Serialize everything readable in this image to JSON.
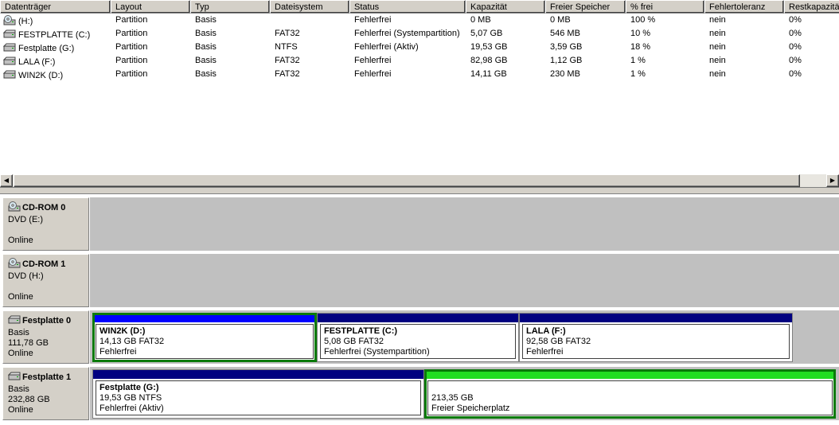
{
  "colors": {
    "primary_bar": "#000080",
    "selected_bar": "#0000ff",
    "free_bar": "#22dd22",
    "selection_border": "#0a7a0a"
  },
  "list": {
    "columns": [
      "Datenträger",
      "Layout",
      "Typ",
      "Dateisystem",
      "Status",
      "Kapazität",
      "Freier Speicher",
      "% frei",
      "Fehlertoleranz",
      "Restkapazität"
    ],
    "rows": [
      {
        "icon": "cd-drive-icon",
        "name": "(H:)",
        "layout": "Partition",
        "type": "Basis",
        "fs": "",
        "status": "Fehlerfrei",
        "capacity": "0 MB",
        "free": "0 MB",
        "pct": "100 %",
        "fault": "nein",
        "rest": "0%"
      },
      {
        "icon": "hard-disk-icon",
        "name": "FESTPLATTE (C:)",
        "layout": "Partition",
        "type": "Basis",
        "fs": "FAT32",
        "status": "Fehlerfrei (Systempartition)",
        "capacity": "5,07 GB",
        "free": "546 MB",
        "pct": "10 %",
        "fault": "nein",
        "rest": "0%"
      },
      {
        "icon": "hard-disk-icon",
        "name": "Festplatte (G:)",
        "layout": "Partition",
        "type": "Basis",
        "fs": "NTFS",
        "status": "Fehlerfrei (Aktiv)",
        "capacity": "19,53 GB",
        "free": "3,59 GB",
        "pct": "18 %",
        "fault": "nein",
        "rest": "0%"
      },
      {
        "icon": "hard-disk-icon",
        "name": "LALA (F:)",
        "layout": "Partition",
        "type": "Basis",
        "fs": "FAT32",
        "status": "Fehlerfrei",
        "capacity": "82,98 GB",
        "free": "1,12 GB",
        "pct": "1 %",
        "fault": "nein",
        "rest": "0%"
      },
      {
        "icon": "hard-disk-icon",
        "name": "WIN2K (D:)",
        "layout": "Partition",
        "type": "Basis",
        "fs": "FAT32",
        "status": "Fehlerfrei",
        "capacity": "14,11 GB",
        "free": "230 MB",
        "pct": "1 %",
        "fault": "nein",
        "rest": "0%"
      }
    ]
  },
  "disks": [
    {
      "icon": "cd-drive-icon",
      "title": "CD-ROM 0",
      "line1": "DVD (E:)",
      "line2": "",
      "line3": "Online",
      "partitions": []
    },
    {
      "icon": "cd-drive-icon",
      "title": "CD-ROM 1",
      "line1": "DVD (H:)",
      "line2": "",
      "line3": "Online",
      "partitions": []
    },
    {
      "icon": "hard-disk-icon",
      "title": "Festplatte 0",
      "line1": "Basis",
      "line2": "111,78 GB",
      "line3": "Online",
      "partitions": [
        {
          "name": "WIN2K  (D:)",
          "size": "14,13 GB FAT32",
          "status": "Fehlerfrei",
          "bar": "selected",
          "selected": true
        },
        {
          "name": "FESTPLATTE  (C:)",
          "size": "5,08 GB FAT32",
          "status": "Fehlerfrei (Systempartition)",
          "bar": "primary",
          "selected": false
        },
        {
          "name": "LALA  (F:)",
          "size": "92,58 GB FAT32",
          "status": "Fehlerfrei",
          "bar": "primary",
          "selected": false
        }
      ]
    },
    {
      "icon": "hard-disk-icon",
      "title": "Festplatte 1",
      "line1": "Basis",
      "line2": "232,88 GB",
      "line3": "Online",
      "partitions": [
        {
          "name": "Festplatte  (G:)",
          "size": "19,53 GB NTFS",
          "status": "Fehlerfrei (Aktiv)",
          "bar": "primary",
          "selected": false
        },
        {
          "name": "",
          "size": "213,35 GB",
          "status": "Freier Speicherplatz",
          "bar": "free",
          "selected": true
        }
      ]
    }
  ]
}
